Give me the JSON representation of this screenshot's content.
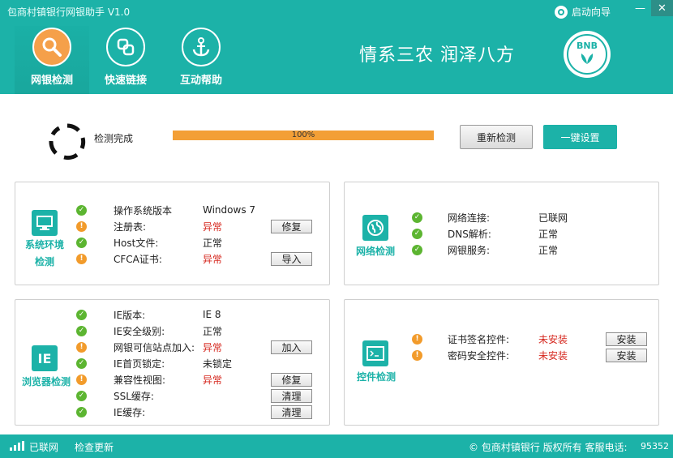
{
  "window": {
    "title": "包商村镇银行网银助手 V1.0",
    "wizard_label": "启动向导",
    "minimize_glyph": "—",
    "close_glyph": "✕"
  },
  "nav": {
    "items": [
      {
        "label": "网银检测",
        "icon": "search-icon",
        "active": true
      },
      {
        "label": "快速链接",
        "icon": "link-icon",
        "active": false
      },
      {
        "label": "互动帮助",
        "icon": "anchor-icon",
        "active": false
      }
    ]
  },
  "header": {
    "slogan": "情系三农 润泽八方",
    "logo_text": "BNB"
  },
  "progress": {
    "status": "检测完成",
    "percent_label": "100%",
    "fraction": 1.0,
    "recheck_label": "重新检测",
    "onekey_label": "一键设置"
  },
  "panels": {
    "system": {
      "title_line1": "系统环境",
      "title_line2": "检测",
      "rows": [
        {
          "status": "ok",
          "key": "操作系统版本",
          "value": "Windows 7",
          "bad": false,
          "button": ""
        },
        {
          "status": "warn",
          "key": "注册表:",
          "value": "异常",
          "bad": true,
          "button": "修复"
        },
        {
          "status": "ok",
          "key": "Host文件:",
          "value": "正常",
          "bad": false,
          "button": ""
        },
        {
          "status": "warn",
          "key": "CFCA证书:",
          "value": "异常",
          "bad": true,
          "button": "导入"
        }
      ]
    },
    "network": {
      "title": "网络检测",
      "rows": [
        {
          "status": "ok",
          "key": "网络连接:",
          "value": "已联网"
        },
        {
          "status": "ok",
          "key": "DNS解析:",
          "value": "正常"
        },
        {
          "status": "ok",
          "key": "网银服务:",
          "value": "正常"
        }
      ]
    },
    "browser": {
      "title": "浏览器检测",
      "icon_text": "IE",
      "rows": [
        {
          "status": "ok",
          "key": "IE版本:",
          "value": "IE 8",
          "bad": false,
          "button": ""
        },
        {
          "status": "ok",
          "key": "IE安全级别:",
          "value": "正常",
          "bad": false,
          "button": ""
        },
        {
          "status": "warn",
          "key": "网银可信站点加入:",
          "value": "异常",
          "bad": true,
          "button": "加入"
        },
        {
          "status": "ok",
          "key": "IE首页锁定:",
          "value": "未锁定",
          "bad": false,
          "button": ""
        },
        {
          "status": "warn",
          "key": "兼容性视图:",
          "value": "异常",
          "bad": true,
          "button": "修复"
        },
        {
          "status": "ok",
          "key": "SSL缓存:",
          "value": "",
          "bad": false,
          "button": "清理"
        },
        {
          "status": "ok",
          "key": "IE缓存:",
          "value": "",
          "bad": false,
          "button": "清理"
        }
      ]
    },
    "control": {
      "title": "控件检测",
      "rows": [
        {
          "status": "warn",
          "key": "证书签名控件:",
          "value": "未安装",
          "button": "安装"
        },
        {
          "status": "warn",
          "key": "密码安全控件:",
          "value": "未安装",
          "button": "安装"
        }
      ]
    }
  },
  "footer": {
    "net_status": "已联网",
    "update_label": "检查更新",
    "copyright": "©  包商村镇银行 版权所有 客服电话:",
    "phone": "95352"
  },
  "colors": {
    "teal": "#1cb2a8",
    "orange": "#f39f36",
    "error_red": "#d6281f",
    "ok_green": "#5cb531",
    "warn_orange": "#f29b2b"
  }
}
